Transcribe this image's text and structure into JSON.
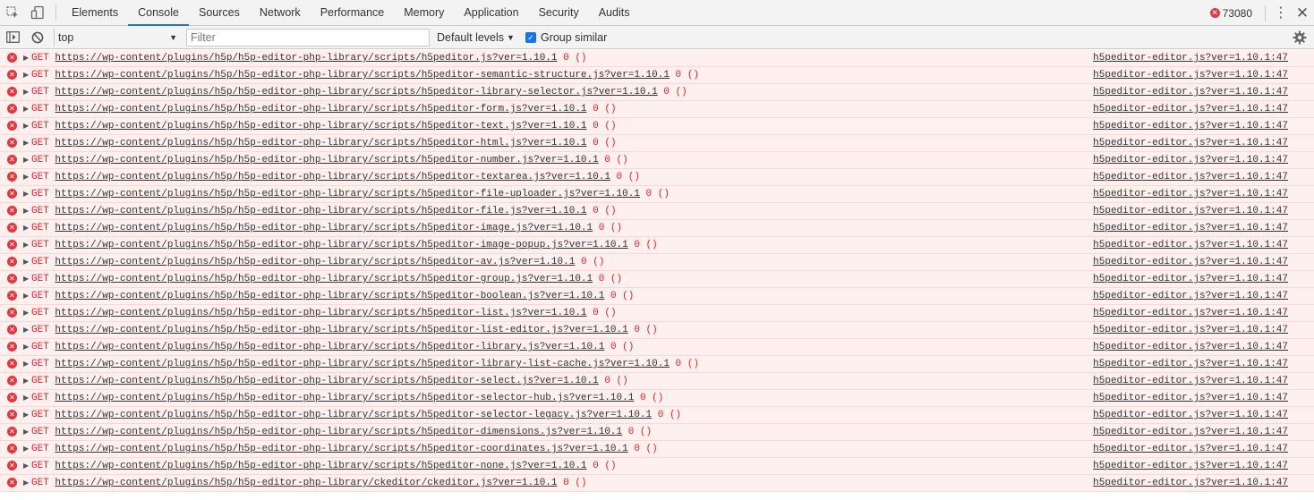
{
  "tabs": [
    "Elements",
    "Console",
    "Sources",
    "Network",
    "Performance",
    "Memory",
    "Application",
    "Security",
    "Audits"
  ],
  "active_tab": "Console",
  "error_badge": {
    "count": "73080"
  },
  "toolbar": {
    "context": "top",
    "filter_placeholder": "Filter",
    "levels": "Default levels",
    "group_similar": "Group similar"
  },
  "colors": {
    "error": "#e0383e",
    "row_bg": "#fff0f0",
    "accent": "#1a73e8"
  },
  "rows": [
    {
      "method": "GET",
      "url": "https://wp-content/plugins/h5p/h5p-editor-php-library/scripts/h5peditor.js?ver=1.10.1",
      "status": "0 ()",
      "source": "h5peditor-editor.js?ver=1.10.1:47"
    },
    {
      "method": "GET",
      "url": "https://wp-content/plugins/h5p/h5p-editor-php-library/scripts/h5peditor-semantic-structure.js?ver=1.10.1",
      "status": "0 ()",
      "source": "h5peditor-editor.js?ver=1.10.1:47"
    },
    {
      "method": "GET",
      "url": "https://wp-content/plugins/h5p/h5p-editor-php-library/scripts/h5peditor-library-selector.js?ver=1.10.1",
      "status": "0 ()",
      "source": "h5peditor-editor.js?ver=1.10.1:47"
    },
    {
      "method": "GET",
      "url": "https://wp-content/plugins/h5p/h5p-editor-php-library/scripts/h5peditor-form.js?ver=1.10.1",
      "status": "0 ()",
      "source": "h5peditor-editor.js?ver=1.10.1:47"
    },
    {
      "method": "GET",
      "url": "https://wp-content/plugins/h5p/h5p-editor-php-library/scripts/h5peditor-text.js?ver=1.10.1",
      "status": "0 ()",
      "source": "h5peditor-editor.js?ver=1.10.1:47"
    },
    {
      "method": "GET",
      "url": "https://wp-content/plugins/h5p/h5p-editor-php-library/scripts/h5peditor-html.js?ver=1.10.1",
      "status": "0 ()",
      "source": "h5peditor-editor.js?ver=1.10.1:47"
    },
    {
      "method": "GET",
      "url": "https://wp-content/plugins/h5p/h5p-editor-php-library/scripts/h5peditor-number.js?ver=1.10.1",
      "status": "0 ()",
      "source": "h5peditor-editor.js?ver=1.10.1:47"
    },
    {
      "method": "GET",
      "url": "https://wp-content/plugins/h5p/h5p-editor-php-library/scripts/h5peditor-textarea.js?ver=1.10.1",
      "status": "0 ()",
      "source": "h5peditor-editor.js?ver=1.10.1:47"
    },
    {
      "method": "GET",
      "url": "https://wp-content/plugins/h5p/h5p-editor-php-library/scripts/h5peditor-file-uploader.js?ver=1.10.1",
      "status": "0 ()",
      "source": "h5peditor-editor.js?ver=1.10.1:47"
    },
    {
      "method": "GET",
      "url": "https://wp-content/plugins/h5p/h5p-editor-php-library/scripts/h5peditor-file.js?ver=1.10.1",
      "status": "0 ()",
      "source": "h5peditor-editor.js?ver=1.10.1:47"
    },
    {
      "method": "GET",
      "url": "https://wp-content/plugins/h5p/h5p-editor-php-library/scripts/h5peditor-image.js?ver=1.10.1",
      "status": "0 ()",
      "source": "h5peditor-editor.js?ver=1.10.1:47"
    },
    {
      "method": "GET",
      "url": "https://wp-content/plugins/h5p/h5p-editor-php-library/scripts/h5peditor-image-popup.js?ver=1.10.1",
      "status": "0 ()",
      "source": "h5peditor-editor.js?ver=1.10.1:47"
    },
    {
      "method": "GET",
      "url": "https://wp-content/plugins/h5p/h5p-editor-php-library/scripts/h5peditor-av.js?ver=1.10.1",
      "status": "0 ()",
      "source": "h5peditor-editor.js?ver=1.10.1:47"
    },
    {
      "method": "GET",
      "url": "https://wp-content/plugins/h5p/h5p-editor-php-library/scripts/h5peditor-group.js?ver=1.10.1",
      "status": "0 ()",
      "source": "h5peditor-editor.js?ver=1.10.1:47"
    },
    {
      "method": "GET",
      "url": "https://wp-content/plugins/h5p/h5p-editor-php-library/scripts/h5peditor-boolean.js?ver=1.10.1",
      "status": "0 ()",
      "source": "h5peditor-editor.js?ver=1.10.1:47"
    },
    {
      "method": "GET",
      "url": "https://wp-content/plugins/h5p/h5p-editor-php-library/scripts/h5peditor-list.js?ver=1.10.1",
      "status": "0 ()",
      "source": "h5peditor-editor.js?ver=1.10.1:47"
    },
    {
      "method": "GET",
      "url": "https://wp-content/plugins/h5p/h5p-editor-php-library/scripts/h5peditor-list-editor.js?ver=1.10.1",
      "status": "0 ()",
      "source": "h5peditor-editor.js?ver=1.10.1:47"
    },
    {
      "method": "GET",
      "url": "https://wp-content/plugins/h5p/h5p-editor-php-library/scripts/h5peditor-library.js?ver=1.10.1",
      "status": "0 ()",
      "source": "h5peditor-editor.js?ver=1.10.1:47"
    },
    {
      "method": "GET",
      "url": "https://wp-content/plugins/h5p/h5p-editor-php-library/scripts/h5peditor-library-list-cache.js?ver=1.10.1",
      "status": "0 ()",
      "source": "h5peditor-editor.js?ver=1.10.1:47"
    },
    {
      "method": "GET",
      "url": "https://wp-content/plugins/h5p/h5p-editor-php-library/scripts/h5peditor-select.js?ver=1.10.1",
      "status": "0 ()",
      "source": "h5peditor-editor.js?ver=1.10.1:47"
    },
    {
      "method": "GET",
      "url": "https://wp-content/plugins/h5p/h5p-editor-php-library/scripts/h5peditor-selector-hub.js?ver=1.10.1",
      "status": "0 ()",
      "source": "h5peditor-editor.js?ver=1.10.1:47"
    },
    {
      "method": "GET",
      "url": "https://wp-content/plugins/h5p/h5p-editor-php-library/scripts/h5peditor-selector-legacy.js?ver=1.10.1",
      "status": "0 ()",
      "source": "h5peditor-editor.js?ver=1.10.1:47"
    },
    {
      "method": "GET",
      "url": "https://wp-content/plugins/h5p/h5p-editor-php-library/scripts/h5peditor-dimensions.js?ver=1.10.1",
      "status": "0 ()",
      "source": "h5peditor-editor.js?ver=1.10.1:47"
    },
    {
      "method": "GET",
      "url": "https://wp-content/plugins/h5p/h5p-editor-php-library/scripts/h5peditor-coordinates.js?ver=1.10.1",
      "status": "0 ()",
      "source": "h5peditor-editor.js?ver=1.10.1:47"
    },
    {
      "method": "GET",
      "url": "https://wp-content/plugins/h5p/h5p-editor-php-library/scripts/h5peditor-none.js?ver=1.10.1",
      "status": "0 ()",
      "source": "h5peditor-editor.js?ver=1.10.1:47"
    },
    {
      "method": "GET",
      "url": "https://wp-content/plugins/h5p/h5p-editor-php-library/ckeditor/ckeditor.js?ver=1.10.1",
      "status": "0 ()",
      "source": "h5peditor-editor.js?ver=1.10.1:47"
    }
  ]
}
